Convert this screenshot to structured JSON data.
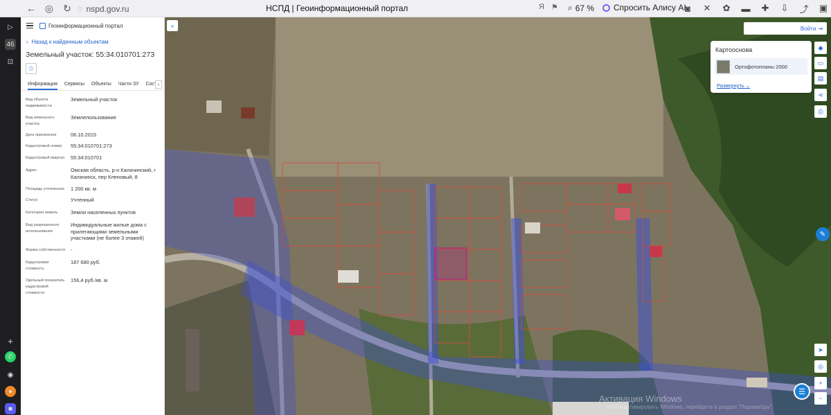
{
  "browser": {
    "url": "nspd.gov.ru",
    "page_title": "НСПД | Геоинформационный портал",
    "zoom": "67 %",
    "alice_label": "Спросить Алису AI"
  },
  "panel": {
    "portal_name": "Геоинформационный портал",
    "back_link": "Назад к найденным объектам",
    "title": "Земельный участок: 55:34:010701:273",
    "tabs": [
      "Информация",
      "Сервисы",
      "Объекты",
      "Части ЗУ",
      "Состав"
    ],
    "rows": [
      {
        "label": "Вид объекта недвижимости",
        "value": "Земельный участок"
      },
      {
        "label": "Вид земельного участка",
        "value": "Землепользование"
      },
      {
        "label": "Дата присвоения",
        "value": "06.10.2015"
      },
      {
        "label": "Кадастровый номер",
        "value": "55:34:010701:273"
      },
      {
        "label": "Кадастровый квартал",
        "value": "55:34:010701"
      },
      {
        "label": "Адрес",
        "value": "Омская область, р-н Калачинский, г Калачинск, пер Кленовый, 8"
      },
      {
        "label": "Площадь уточненная",
        "value": "1 200 кв. м"
      },
      {
        "label": "Статус",
        "value": "Учтенный"
      },
      {
        "label": "Категория земель",
        "value": "Земли населенных пунктов"
      },
      {
        "label": "Вид разрешенного использования",
        "value": "Индивидуальные жилые дома с прилегающими земельными участками (не более 3 этажей)"
      },
      {
        "label": "Форма собственности",
        "value": "-"
      },
      {
        "label": "Кадастровая стоимость",
        "value": "187 680 руб."
      },
      {
        "label": "Удельный показатель кадастровой стоимости",
        "value": "156,4 руб./кв. м"
      }
    ]
  },
  "map": {
    "login_label": "Войти",
    "basemap_title": "Картооснова",
    "basemap_item": "Ортофотопланы 2000",
    "basemap_expand": "Развернуть",
    "watermark": "Активация Windows",
    "watermark_sub": "Чтобы активировать Windows, перейдите в раздел \"Параметры\"."
  },
  "colors": {
    "accent": "#2b6cd8",
    "parcel_border": "#d84a3a",
    "selected_parcel": "#b0307a",
    "zone_overlay": "#3b4fd8"
  }
}
